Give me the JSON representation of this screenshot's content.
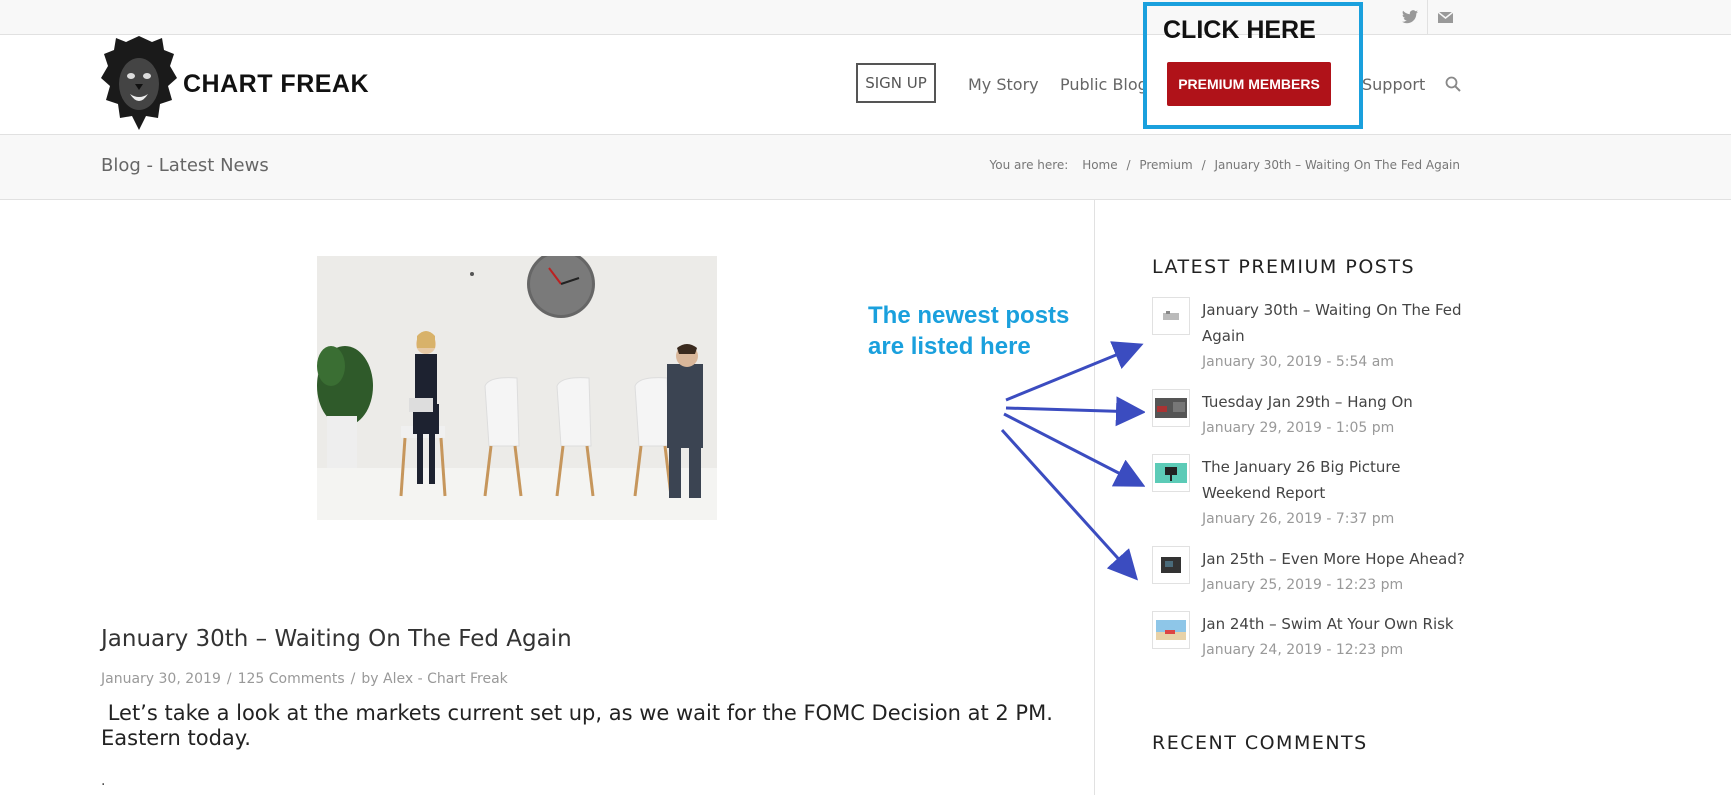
{
  "social": {
    "twitter_icon": "twitter-icon",
    "mail_icon": "mail-icon"
  },
  "brand": {
    "name": "CHART FREAK",
    "logo_icon": "lion-logo"
  },
  "nav": {
    "signup": "SIGN UP",
    "my_story": "My Story",
    "public_blog": "Public Blog",
    "premium": "PREMIUM MEMBERS",
    "support": "Support",
    "search_icon": "search-icon"
  },
  "callout": {
    "label": "CLICK HERE",
    "color": "#1aa0dd"
  },
  "titlebar": {
    "title": "Blog - Latest News",
    "breadcrumb_prefix": "You are here:",
    "crumbs": [
      "Home",
      "Premium",
      "January 30th – Waiting On The Fed Again"
    ]
  },
  "post": {
    "title": "January 30th – Waiting On The Fed Again",
    "date": "January 30, 2019",
    "comments": "125 Comments",
    "by": "by",
    "author": "Alex - Chart Freak",
    "excerpt": " Let’s take a look at the markets current set up, as we wait for the FOMC Decision at 2 PM. Eastern today.",
    "trailing": "."
  },
  "annotation": {
    "line1": "The newest posts",
    "line2": "are listed here"
  },
  "sidebar": {
    "latest_heading": "LATEST PREMIUM POSTS",
    "posts": [
      {
        "title": "January 30th – Waiting On The Fed Again",
        "date": "January 30, 2019 - 5:54 am"
      },
      {
        "title": "Tuesday Jan 29th – Hang On",
        "date": "January 29, 2019 - 1:05 pm"
      },
      {
        "title": "The January 26 Big Picture Weekend Report",
        "date": "January 26, 2019 - 7:37 pm"
      },
      {
        "title": "Jan 25th – Even More Hope Ahead?",
        "date": "January 25, 2019 - 12:23 pm"
      },
      {
        "title": "Jan 24th – Swim At Your Own Risk",
        "date": "January 24, 2019 - 12:23 pm"
      }
    ],
    "comments_heading": "RECENT COMMENTS"
  },
  "colors": {
    "premium_button": "#b01219",
    "arrows": "#3b4cc0",
    "callout_border": "#1aa0dd"
  }
}
